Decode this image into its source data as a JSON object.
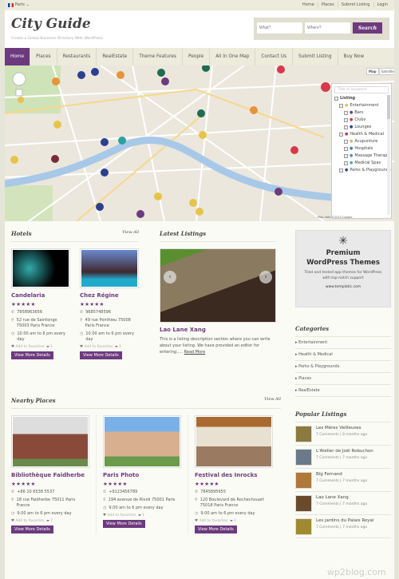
{
  "topbar": {
    "city": "Paris",
    "links": [
      "Home",
      "Places",
      "Submit Listing",
      "Login"
    ]
  },
  "header": {
    "logo": "City Guide",
    "tagline": "Create a Global Business Directory With WordPress",
    "search": {
      "what_placeholder": "What?",
      "where_placeholder": "Where?",
      "button": "Search"
    }
  },
  "nav": [
    "Home",
    "Places",
    "Restaurants",
    "RealEstate",
    "Theme Features",
    "People",
    "All In One Map",
    "Contact Us",
    "Submit Listing",
    "Buy Now"
  ],
  "map": {
    "buttons": [
      "Map",
      "Satellite"
    ],
    "keyword_placeholder": "Title or keyword",
    "footer": "Map data ©2014 Google",
    "tree": [
      {
        "label": "Listing",
        "level": 0
      },
      {
        "label": "Entertainment",
        "level": 1,
        "color": "#e8c34a"
      },
      {
        "label": "Bars",
        "level": 2,
        "color": "#6d3a7e"
      },
      {
        "label": "Clubs",
        "level": 2,
        "color": "#d63a4a"
      },
      {
        "label": "Lounges",
        "level": 2,
        "color": "#2a3f8f"
      },
      {
        "label": "Health & Medical",
        "level": 1,
        "color": "#c2384e"
      },
      {
        "label": "Acupunture",
        "level": 2,
        "color": "#e0b27a"
      },
      {
        "label": "Hospitals",
        "level": 2,
        "color": "#2a8f8f"
      },
      {
        "label": "Massage Therapy",
        "level": 2,
        "color": "#5a8fa0"
      },
      {
        "label": "Medical Spas",
        "level": 2,
        "color": "#4aaac0"
      },
      {
        "label": "Parks & Playgrounds",
        "level": 1,
        "color": "#2a4f8f"
      }
    ]
  },
  "hotels": {
    "title": "Hotels",
    "view_all": "View All",
    "items": [
      {
        "name": "Candelaria",
        "rating": 5,
        "phone": "7858963656",
        "address": "52 rue de Saintonge 75003 Paris France",
        "hours": "10.00 am to 6 pm every day",
        "favorite": "Add to favorites",
        "comments": "1",
        "button": "View More Details"
      },
      {
        "name": "Chez Régine",
        "rating": 5,
        "phone": "9685748596",
        "address": "49 rue Ponthieu 75008 Paris France",
        "hours": "10.00 am to 6 pm every day",
        "favorite": "Add to favorites",
        "comments": "1",
        "button": "View More Details"
      }
    ]
  },
  "latest": {
    "title": "Latest Listings",
    "name": "Lao Lane Xang",
    "description": "This is a listing description section where you can write about your listing. We have provided an editor for entering.....",
    "read_more": "Read More"
  },
  "ad": {
    "title": "Premium WordPress Themes",
    "subtitle": "Tried and tested app themes for WordPress with top-notch support",
    "url": "www.templatic.com"
  },
  "categories": {
    "title": "Categories",
    "items": [
      "Entertainment",
      "Health & Medical",
      "Parks & Playgrounds",
      "Places",
      "RealEstate"
    ]
  },
  "nearby": {
    "title": "Nearby Places",
    "view_all": "View All",
    "items": [
      {
        "name": "Bibliothèque Faidherbe",
        "rating": 5,
        "phone": "+86 10 6538 5537",
        "address": "18 rue Faidherbe 75011 Paris France",
        "hours": "9.00 am to 6 pm every day",
        "favorite": "Add to favorites",
        "comments": "7",
        "button": "View More Details"
      },
      {
        "name": "Paris Photo",
        "rating": 5,
        "phone": "+9123456789",
        "address": "194 avenue de Rivoli 75001 Paris",
        "hours": "9.00 am to 6 pm every day",
        "favorite": "Add to favorites",
        "comments": "1",
        "button": "View More Details"
      },
      {
        "name": "Festival des Inrocks",
        "rating": 5,
        "phone": "7845895655",
        "address": "120 Boulevard de Rochechouart 75018 Paris France",
        "hours": "9.00 am to 6 pm every day",
        "favorite": "Add to favorites",
        "comments": "1",
        "button": "View More Details"
      }
    ]
  },
  "popular": {
    "title": "Popular Listings",
    "items": [
      {
        "name": "Les Mères Veilleuses",
        "comments": "7 Comments",
        "ago": "8 months ago"
      },
      {
        "name": "L'Atelier de Joël Robuchon",
        "comments": "7 Comments",
        "ago": "7 months ago"
      },
      {
        "name": "Big Fernand",
        "comments": "7 Comments",
        "ago": "7 months ago"
      },
      {
        "name": "Lao Lane Xang",
        "comments": "7 Comments",
        "ago": "7 months ago"
      },
      {
        "name": "Les jardins du Palais Royal",
        "comments": "7 Comments",
        "ago": "7 months ago"
      }
    ]
  },
  "watermark": "wp2blog.com",
  "colors": {
    "accent": "#6d3a7e",
    "background": "#e6e5d9"
  }
}
